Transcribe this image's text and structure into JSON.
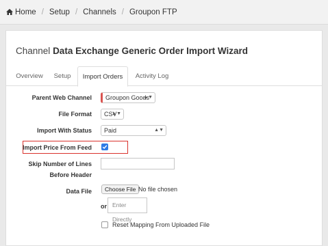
{
  "breadcrumb": {
    "items": [
      "Home",
      "Setup",
      "Channels",
      "Groupon FTP"
    ],
    "separator": "/"
  },
  "wizard": {
    "title_prefix": "Channel",
    "title_main": "Data Exchange Generic Order Import Wizard"
  },
  "tabs": [
    {
      "label": "Overview",
      "active": false
    },
    {
      "label": "Setup",
      "active": false
    },
    {
      "label": "Import Orders",
      "active": true
    },
    {
      "label": "Activity Log",
      "active": false
    }
  ],
  "form": {
    "parent_web_channel": {
      "label": "Parent Web Channel",
      "value": "Groupon Goods"
    },
    "file_format": {
      "label": "File Format",
      "value": "CSV"
    },
    "import_with_status": {
      "label": "Import With Status",
      "value": "Paid"
    },
    "import_price_from_feed": {
      "label": "Import Price From Feed",
      "checked": true
    },
    "skip_lines": {
      "label_line1": "Skip Number of Lines",
      "label_line2": "Before Header",
      "value": ""
    },
    "data_file": {
      "label": "Data File",
      "button": "Choose File",
      "status": "No file chosen"
    },
    "or_label": "or",
    "enter_directly_placeholder": "Enter Directly",
    "reset_mapping": {
      "label": "Reset Mapping From Uploaded File",
      "checked": false
    }
  },
  "colors": {
    "accent": "#2f7ae5",
    "highlight": "#d9312b"
  }
}
